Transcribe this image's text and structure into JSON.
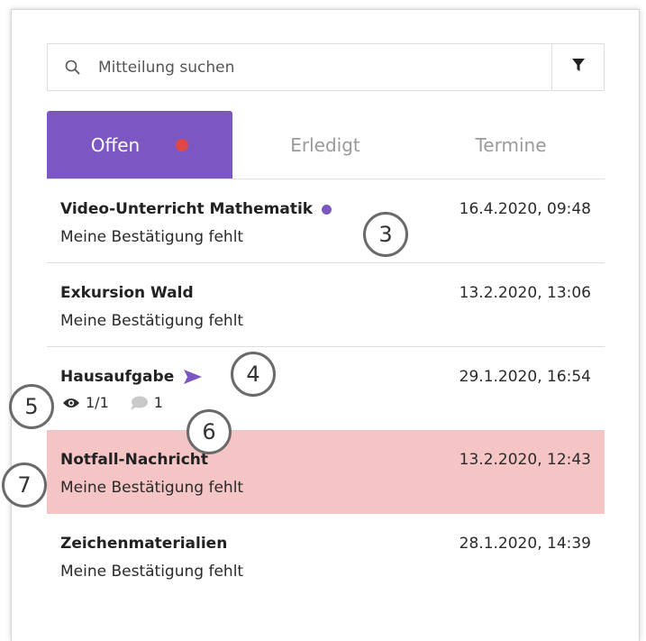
{
  "search": {
    "placeholder": "Mitteilung suchen",
    "value": ""
  },
  "tabs": [
    {
      "label": "Offen",
      "active": true,
      "has_notification": true
    },
    {
      "label": "Erledigt",
      "active": false
    },
    {
      "label": "Termine",
      "active": false
    }
  ],
  "messages": [
    {
      "title": "Video-Unterricht Mathematik",
      "subtitle": "Meine Bestätigung fehlt",
      "date": "16.4.2020, 09:48",
      "unread_dot": true
    },
    {
      "title": "Exkursion Wald",
      "subtitle": "Meine Bestätigung fehlt",
      "date": "13.2.2020, 13:06"
    },
    {
      "title": "Hausaufgabe",
      "date": "29.1.2020, 16:54",
      "sent": true,
      "views": "1/1",
      "comments": "1"
    },
    {
      "title": "Notfall-Nachricht",
      "subtitle": "Meine Bestätigung fehlt",
      "date": "13.2.2020, 12:43",
      "highlighted": true
    },
    {
      "title": "Zeichenmaterialien",
      "subtitle": "Meine Bestätigung fehlt",
      "date": "28.1.2020, 14:39"
    }
  ],
  "callouts": [
    "3",
    "4",
    "5",
    "6",
    "7"
  ],
  "colors": {
    "accent": "#7d57c1",
    "notification": "#e04848",
    "highlight_row": "#f5c5c6"
  }
}
